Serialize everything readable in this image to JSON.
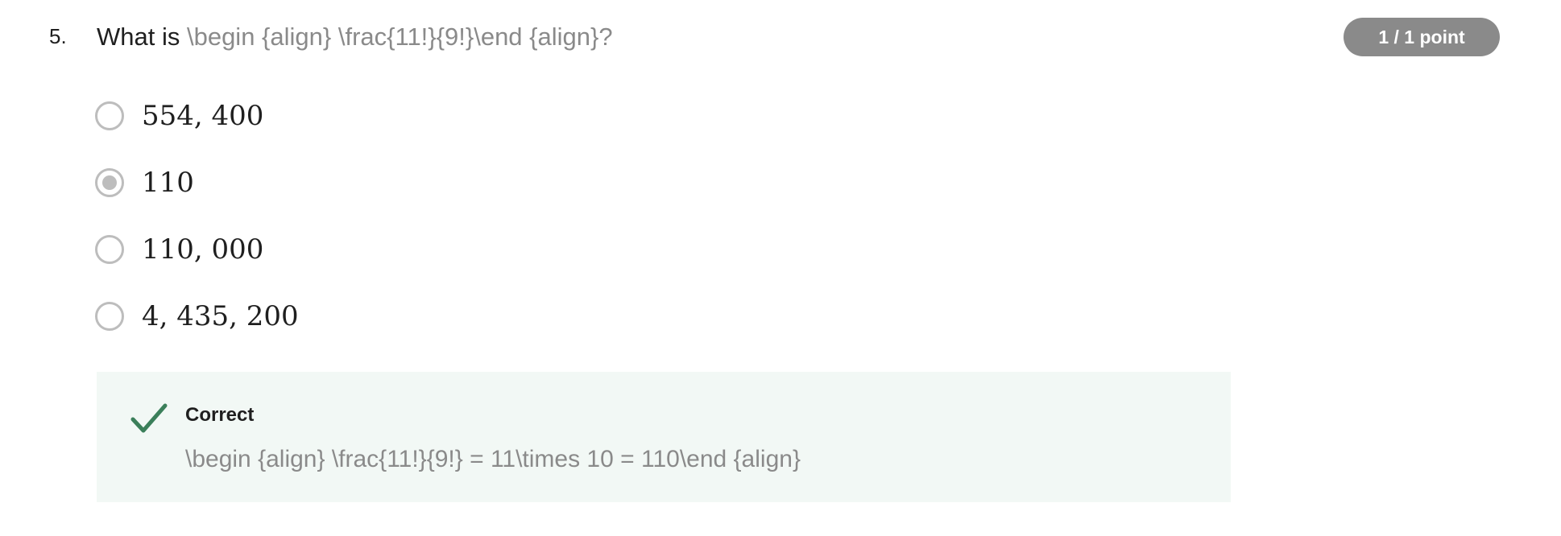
{
  "question": {
    "number": "5.",
    "prefix": "What is ",
    "latex": "\\begin {align} \\frac{11!}{9!}\\end {align}?",
    "points": "1 / 1 point"
  },
  "options": [
    {
      "label": "554, 400",
      "selected": false
    },
    {
      "label": "110",
      "selected": true
    },
    {
      "label": "110, 000",
      "selected": false
    },
    {
      "label": "4, 435, 200",
      "selected": false
    }
  ],
  "feedback": {
    "title": "Correct",
    "body": "\\begin {align} \\frac{11!}{9!} = 11\\times 10 = 110\\end {align}",
    "icon": "check-icon",
    "accent_color": "#3b7f5a"
  },
  "colors": {
    "badge_bg": "#8a8a8a",
    "muted_text": "#8a8a8a",
    "feedback_bg": "#f2f8f5",
    "radio_border": "#bdbdbd"
  }
}
